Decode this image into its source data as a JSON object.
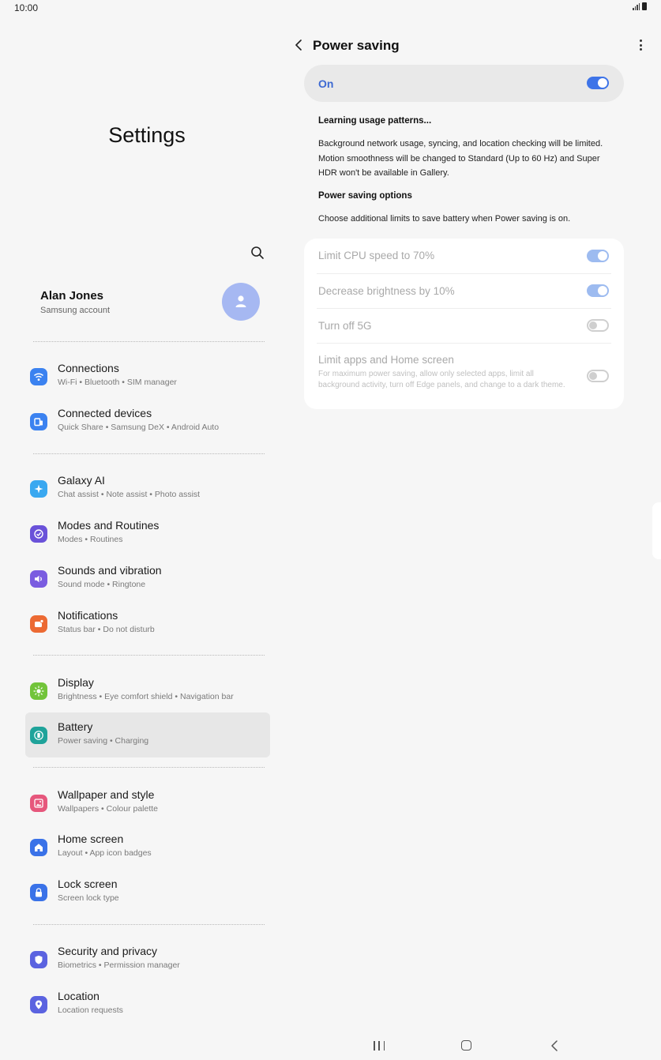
{
  "status_bar": {
    "time": "10:00"
  },
  "left_pane": {
    "title": "Settings",
    "profile": {
      "name": "Alan Jones",
      "subtitle": "Samsung account"
    },
    "menu": [
      {
        "label": "Connections",
        "sub": "Wi-Fi • Bluetooth • SIM manager",
        "icon": "wifi-icon",
        "color": "#3b82f0"
      },
      {
        "label": "Connected devices",
        "sub": "Quick Share • Samsung DeX • Android Auto",
        "icon": "devices-icon",
        "color": "#3b82f0"
      },
      {
        "label": "Galaxy AI",
        "sub": "Chat assist • Note assist • Photo assist",
        "icon": "sparkle-icon",
        "color": "#3aa8f0"
      },
      {
        "label": "Modes and Routines",
        "sub": "Modes • Routines",
        "icon": "check-circle-icon",
        "color": "#6a52d9"
      },
      {
        "label": "Sounds and vibration",
        "sub": "Sound mode • Ringtone",
        "icon": "speaker-icon",
        "color": "#7a5ce0"
      },
      {
        "label": "Notifications",
        "sub": "Status bar • Do not disturb",
        "icon": "bell-badge-icon",
        "color": "#ec6a33"
      },
      {
        "label": "Display",
        "sub": "Brightness • Eye comfort shield • Navigation bar",
        "icon": "sun-icon",
        "color": "#72c43a"
      },
      {
        "label": "Battery",
        "sub": "Power saving • Charging",
        "icon": "battery-icon",
        "color": "#1fa39a"
      },
      {
        "label": "Wallpaper and style",
        "sub": "Wallpapers • Colour palette",
        "icon": "image-icon",
        "color": "#e6577c"
      },
      {
        "label": "Home screen",
        "sub": "Layout • App icon badges",
        "icon": "home-icon",
        "color": "#3a72e8"
      },
      {
        "label": "Lock screen",
        "sub": "Screen lock type",
        "icon": "lock-icon",
        "color": "#3a72e8"
      },
      {
        "label": "Security and privacy",
        "sub": "Biometrics • Permission manager",
        "icon": "shield-icon",
        "color": "#5b63e0"
      },
      {
        "label": "Location",
        "sub": "Location requests",
        "icon": "location-pin-icon",
        "color": "#5b63e0"
      }
    ]
  },
  "right_pane": {
    "title": "Power saving",
    "master": {
      "label": "On",
      "state": "on"
    },
    "status_heading": "Learning usage patterns...",
    "description": "Background network usage, syncing, and location checking will be limited. Motion smoothness will be changed to Standard (Up to 60 Hz) and Super HDR won't be available in Gallery.",
    "options_heading": "Power saving options",
    "options_text": "Choose additional limits to save battery when Power saving is on.",
    "options": [
      {
        "label": "Limit CPU speed to 70%",
        "state": "on"
      },
      {
        "label": "Decrease brightness by 10%",
        "state": "on"
      },
      {
        "label": "Turn off 5G",
        "state": "off"
      },
      {
        "label": "Limit apps and Home screen",
        "desc": "For maximum power saving, allow only selected apps, limit all background activity, turn off Edge panels, and change to a dark theme.",
        "state": "off"
      }
    ]
  }
}
